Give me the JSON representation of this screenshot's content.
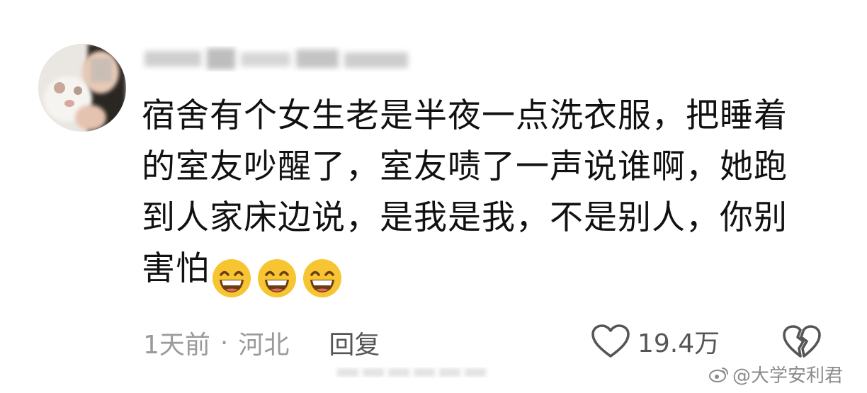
{
  "comment": {
    "username": "",
    "text": "宿舍有个女生老是半夜一点洗衣服，把睡着\n的室友吵醒了，室友啧了一声说谁啊，她跑\n到人家床边说，是我是我，不是别人，你别\n害怕",
    "emojis": [
      "grin-emoji",
      "grin-emoji",
      "grin-emoji"
    ]
  },
  "meta": {
    "time": "1天前",
    "separator": "·",
    "location": "河北",
    "reply_label": "回复"
  },
  "like": {
    "count": "19.4万",
    "icon": "heart-icon"
  },
  "dislike": {
    "icon": "broken-heart-icon"
  },
  "watermark": {
    "text": "@大学安利君",
    "icon": "weibo-icon"
  },
  "colors": {
    "text": "#111111",
    "meta": "#9a9a9a",
    "action": "#555555",
    "emoji": "#f7c531"
  }
}
